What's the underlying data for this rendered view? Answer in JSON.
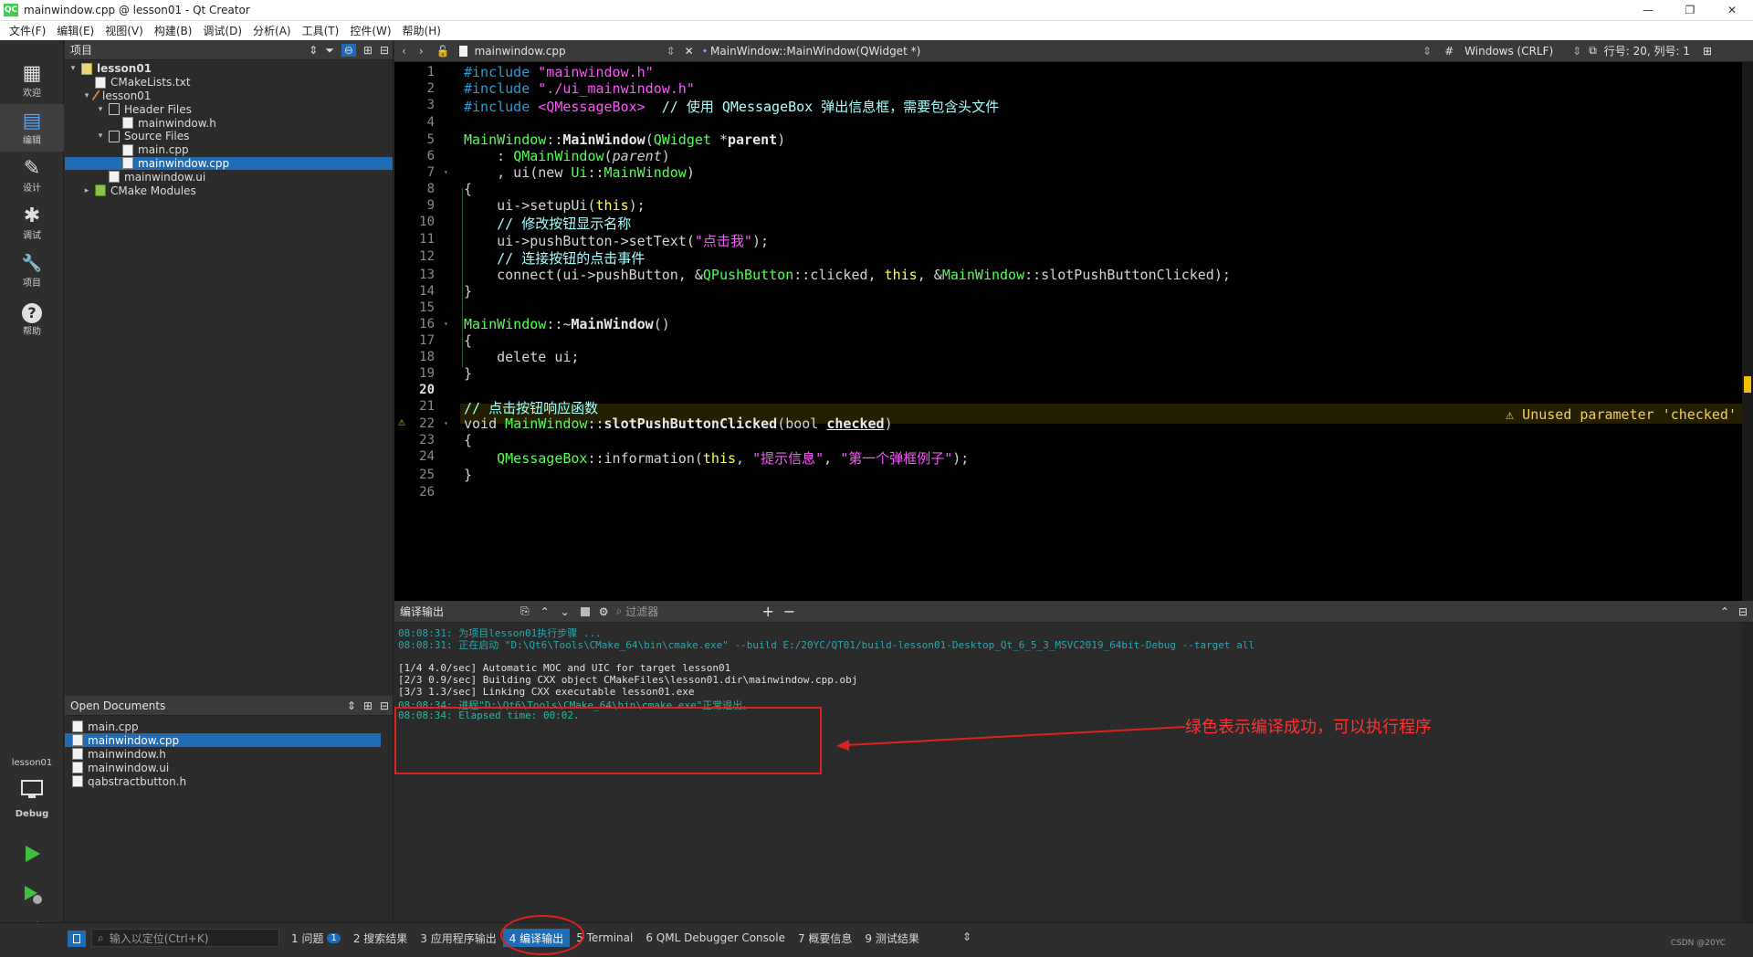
{
  "window": {
    "title": "mainwindow.cpp @ lesson01 - Qt Creator",
    "app_badge": "QC",
    "minimize": "—",
    "maximize": "❐",
    "close": "✕"
  },
  "menu": [
    "文件(F)",
    "编辑(E)",
    "视图(V)",
    "构建(B)",
    "调试(D)",
    "分析(A)",
    "工具(T)",
    "控件(W)",
    "帮助(H)"
  ],
  "modes": [
    {
      "label": "欢迎",
      "icon": "grid-icon",
      "glyph": "▦"
    },
    {
      "label": "编辑",
      "icon": "edit-doc-icon",
      "glyph": "▤"
    },
    {
      "label": "设计",
      "icon": "pencil-icon",
      "glyph": "✎"
    },
    {
      "label": "调试",
      "icon": "bug-icon",
      "glyph": "✱"
    },
    {
      "label": "项目",
      "icon": "wrench-icon",
      "glyph": "🔧"
    },
    {
      "label": "帮助",
      "icon": "help-icon",
      "glyph": "?"
    }
  ],
  "kit": {
    "project": "lesson01",
    "config": "Debug"
  },
  "project_panel": {
    "title": "项目",
    "tree": [
      {
        "label": "lesson01",
        "depth": 0,
        "arrow": "▾",
        "icon": "proj",
        "bold": true
      },
      {
        "label": "CMakeLists.txt",
        "depth": 1,
        "arrow": "",
        "icon": "doc"
      },
      {
        "label": "lesson01",
        "depth": 1,
        "arrow": "▾",
        "icon": "tool"
      },
      {
        "label": "Header Files",
        "depth": 2,
        "arrow": "▾",
        "icon": "folder"
      },
      {
        "label": "mainwindow.h",
        "depth": 3,
        "arrow": "",
        "icon": "doc"
      },
      {
        "label": "Source Files",
        "depth": 2,
        "arrow": "▾",
        "icon": "folder"
      },
      {
        "label": "main.cpp",
        "depth": 3,
        "arrow": "",
        "icon": "doc"
      },
      {
        "label": "mainwindow.cpp",
        "depth": 3,
        "arrow": "",
        "icon": "doc",
        "selected": true
      },
      {
        "label": "mainwindow.ui",
        "depth": 2,
        "arrow": "",
        "icon": "ui"
      },
      {
        "label": "CMake Modules",
        "depth": 1,
        "arrow": "▸",
        "icon": "cm"
      }
    ]
  },
  "open_documents": {
    "title": "Open Documents",
    "items": [
      {
        "label": "main.cpp",
        "selected": false
      },
      {
        "label": "mainwindow.cpp",
        "selected": true
      },
      {
        "label": "mainwindow.h",
        "selected": false
      },
      {
        "label": "mainwindow.ui",
        "selected": false
      },
      {
        "label": "qabstractbutton.h",
        "selected": false
      }
    ]
  },
  "editor_header": {
    "file": "mainwindow.cpp",
    "symbol": "MainWindow::MainWindow(QWidget *)",
    "hash": "#",
    "line_ending": "Windows (CRLF)",
    "position": "行号: 20, 列号: 1"
  },
  "editor": {
    "current_line": 20,
    "warning_line": 22,
    "warning_text": "⚠ Unused parameter 'checked'",
    "lines": [
      1,
      2,
      3,
      4,
      5,
      6,
      7,
      8,
      9,
      10,
      11,
      12,
      13,
      14,
      15,
      16,
      17,
      18,
      19,
      20,
      21,
      22,
      23,
      24,
      25,
      26
    ]
  },
  "output": {
    "title": "编译输出",
    "filter_placeholder": "过滤器",
    "lines": [
      {
        "text": "08:08:31: 为项目lesson01执行步骤 ...",
        "cls": "cyan"
      },
      {
        "text": "08:08:31: 正在启动 \"D:\\Qt6\\Tools\\CMake_64\\bin\\cmake.exe\" --build E:/20YC/QT01/build-lesson01-Desktop_Qt_6_5_3_MSVC2019_64bit-Debug --target all",
        "cls": "cyan"
      },
      {
        "text": "",
        "cls": "white"
      },
      {
        "text": "[1/4 4.0/sec] Automatic MOC and UIC for target lesson01",
        "cls": "white"
      },
      {
        "text": "[2/3 0.9/sec] Building CXX object CMakeFiles\\lesson01.dir\\mainwindow.cpp.obj",
        "cls": "white"
      },
      {
        "text": "[3/3 1.3/sec] Linking CXX executable lesson01.exe",
        "cls": "white"
      },
      {
        "text": "08:08:34: 进程\"D:\\Qt6\\Tools\\CMake_64\\bin\\cmake.exe\"正常退出。",
        "cls": "green"
      },
      {
        "text": "08:08:34: Elapsed time: 00:02.",
        "cls": "green"
      }
    ],
    "annotation": "绿色表示编译成功，可以执行程序"
  },
  "statusbar": {
    "locator_placeholder": "输入以定位(Ctrl+K)",
    "tabs": [
      {
        "label": "1 问题",
        "badge": "1",
        "active": false
      },
      {
        "label": "2 搜索结果",
        "badge": "",
        "active": false
      },
      {
        "label": "3 应用程序输出",
        "badge": "",
        "active": false
      },
      {
        "label": "4 编译输出",
        "badge": "",
        "active": true
      },
      {
        "label": "5 Terminal",
        "badge": "",
        "active": false
      },
      {
        "label": "6 QML Debugger Console",
        "badge": "",
        "active": false
      },
      {
        "label": "7 概要信息",
        "badge": "",
        "active": false
      },
      {
        "label": "9 测试结果",
        "badge": "",
        "active": false
      }
    ],
    "watermark": "CSDN @20YC"
  }
}
